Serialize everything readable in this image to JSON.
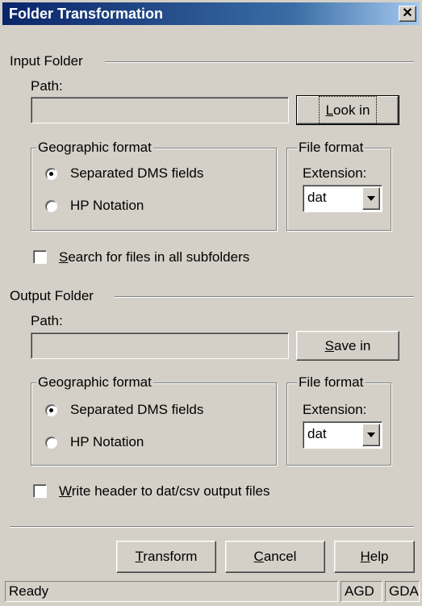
{
  "window": {
    "title": "Folder Transformation",
    "close_symbol": "✕"
  },
  "input": {
    "section_label": "Input Folder",
    "path_label": "Path:",
    "path_value": "",
    "look_in_button": {
      "prefix": "",
      "hotkey": "L",
      "rest": "ook in"
    },
    "geo_group_title": "Geographic format",
    "geo_options": [
      "Separated DMS fields",
      "HP Notation"
    ],
    "geo_selected": "Separated DMS fields",
    "file_group_title": "File format",
    "extension_label": "Extension:",
    "extension_value": "dat",
    "subfolders_checkbox": {
      "prefix": "",
      "hotkey": "S",
      "rest": "earch for files in all subfolders",
      "checked": false
    }
  },
  "output": {
    "section_label": "Output Folder",
    "path_label": "Path:",
    "path_value": "",
    "save_in_button": {
      "prefix": "",
      "hotkey": "S",
      "rest": "ave in"
    },
    "geo_group_title": "Geographic format",
    "geo_options": [
      "Separated DMS fields",
      "HP Notation"
    ],
    "geo_selected": "Separated DMS fields",
    "file_group_title": "File format",
    "extension_label": "Extension:",
    "extension_value": "dat",
    "header_checkbox": {
      "prefix": "",
      "hotkey": "W",
      "rest": "rite header to dat/csv output files",
      "checked": false
    }
  },
  "actions": {
    "transform": {
      "hotkey": "T",
      "rest": "ransform"
    },
    "cancel": {
      "hotkey": "C",
      "rest": "ancel"
    },
    "help": {
      "hotkey": "H",
      "rest": "elp"
    }
  },
  "statusbar": {
    "status": "Ready",
    "cell1": "AGD",
    "cell2": "GDA"
  }
}
